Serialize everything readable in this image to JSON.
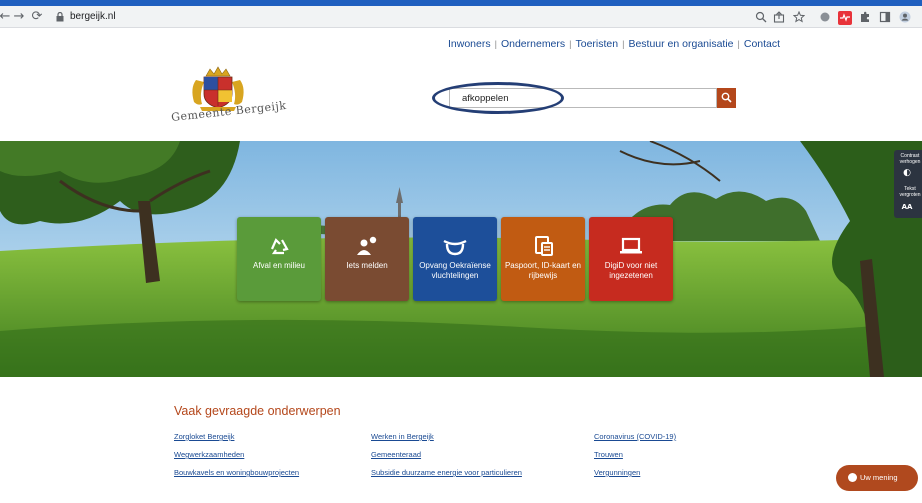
{
  "browser": {
    "url": "bergeijk.nl",
    "back_glyph": "←",
    "forward_glyph": "→",
    "reload_glyph": "⟳",
    "lock_glyph": "🔒"
  },
  "topnav": {
    "items": [
      "Inwoners",
      "Ondernemers",
      "Toeristen",
      "Bestuur en organisatie",
      "Contact"
    ],
    "separator": "|"
  },
  "logo": {
    "text": "Gemeente Bergeijk"
  },
  "search": {
    "value": "afkoppelen",
    "button_color": "#b4471b"
  },
  "tiles": [
    {
      "label": "Afval en milieu",
      "icon": "recycle-icon",
      "color": "#5a9b3a"
    },
    {
      "label": "Iets melden",
      "icon": "report-person-icon",
      "color": "#7a4b32"
    },
    {
      "label": "Opvang Oekraïense vluchtelingen",
      "icon": "shelter-heart-icon",
      "color": "#1d4f9a"
    },
    {
      "label": "Paspoort, ID-kaart en rijbewijs",
      "icon": "id-card-icon",
      "color": "#c15b12"
    },
    {
      "label": "DigiD voor niet ingezetenen",
      "icon": "laptop-icon",
      "color": "#c62b1f"
    }
  ],
  "a11y": {
    "contrast_label": "Contrast verhogen",
    "text_label": "Tekst vergroten",
    "contrast_glyph": "◐",
    "text_glyph": "AA"
  },
  "section": {
    "title": "Vaak gevraagde onderwerpen",
    "col1": [
      "Zorgloket Bergeijk",
      "Wegwerkzaamheden",
      "Bouwkavels en woningbouwprojecten"
    ],
    "col2": [
      "Werken in Bergeijk",
      "Gemeenteraad",
      "Subsidie duurzame energie voor particulieren"
    ],
    "col3": [
      "Coronavirus (COVID-19)",
      "Trouwen",
      "Vergunningen"
    ]
  },
  "feedback": {
    "label": "Uw mening"
  }
}
